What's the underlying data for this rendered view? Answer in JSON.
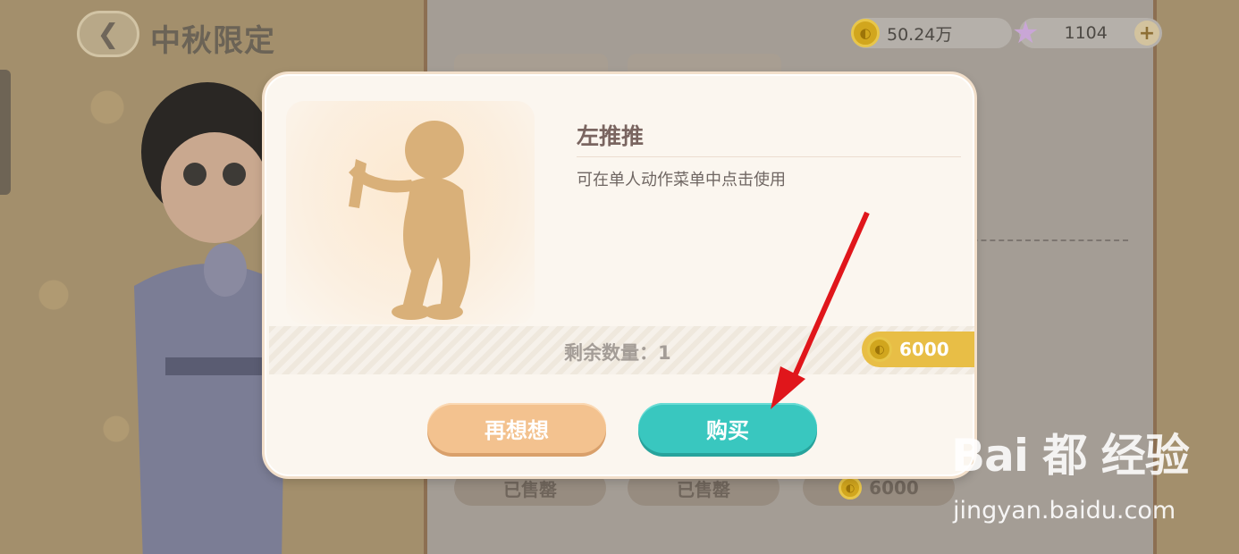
{
  "header": {
    "back_icon": "chevron-left-icon",
    "title": "中秋限定"
  },
  "currency": {
    "coins": "50.24万",
    "coin_icon": "coin-icon",
    "stars": "1104",
    "star_icon": "star-icon",
    "add_icon": "plus-icon"
  },
  "shop_background": {
    "sold_labels": [
      "已售罄",
      "已售罄"
    ],
    "price_label": "6000"
  },
  "dialog": {
    "item_name": "左推推",
    "item_description": "可在单人动作菜单中点击使用",
    "remaining": "剩余数量：1",
    "price": "6000",
    "cancel_label": "再想想",
    "buy_label": "购买",
    "preview_icon": "push-left-pose-icon"
  },
  "watermark": {
    "logo": "Bai 都 经验",
    "url": "jingyan.baidu.com"
  },
  "colors": {
    "buy_button": "#39c7bf",
    "cancel_button": "#f3c28f",
    "price_tag": "#e8be46",
    "annotation_arrow": "#e0161b"
  }
}
